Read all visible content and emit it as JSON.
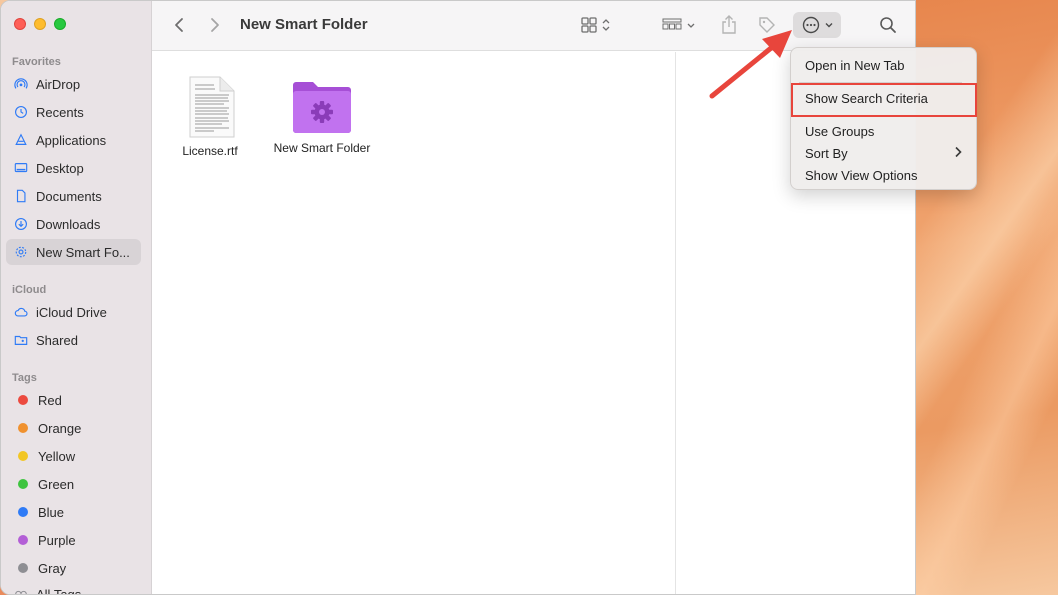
{
  "window": {
    "title": "New Smart Folder"
  },
  "sidebar": {
    "favorites_heading": "Favorites",
    "favorites": [
      {
        "label": "AirDrop",
        "icon": "airdrop-icon"
      },
      {
        "label": "Recents",
        "icon": "clock-icon"
      },
      {
        "label": "Applications",
        "icon": "applications-icon"
      },
      {
        "label": "Desktop",
        "icon": "desktop-icon"
      },
      {
        "label": "Documents",
        "icon": "document-icon"
      },
      {
        "label": "Downloads",
        "icon": "download-icon"
      },
      {
        "label": "New Smart Fo...",
        "icon": "gear-icon",
        "selected": true
      }
    ],
    "icloud_heading": "iCloud",
    "icloud": [
      {
        "label": "iCloud Drive",
        "icon": "cloud-icon"
      },
      {
        "label": "Shared",
        "icon": "shared-folder-icon"
      }
    ],
    "tags_heading": "Tags",
    "tags": [
      {
        "label": "Red",
        "color": "#ec4a3f"
      },
      {
        "label": "Orange",
        "color": "#f0912e"
      },
      {
        "label": "Yellow",
        "color": "#f2c624"
      },
      {
        "label": "Green",
        "color": "#3ec43f"
      },
      {
        "label": "Blue",
        "color": "#2f7bf6"
      },
      {
        "label": "Purple",
        "color": "#b35fd6"
      },
      {
        "label": "Gray",
        "color": "#8e8e93"
      },
      {
        "label": "All Tags...",
        "color": ""
      }
    ]
  },
  "files": [
    {
      "name": "License.rtf",
      "icon": "rtf-document-icon"
    },
    {
      "name": "New Smart Folder",
      "icon": "smart-folder-icon"
    }
  ],
  "menu": {
    "items": [
      "Open in New Tab",
      "Show Search Criteria",
      "Use Groups",
      "Sort By",
      "Show View Options"
    ]
  },
  "colors": {
    "accent": "#2f7bf6",
    "highlight": "#e8453c",
    "folder": "#b960e6"
  }
}
